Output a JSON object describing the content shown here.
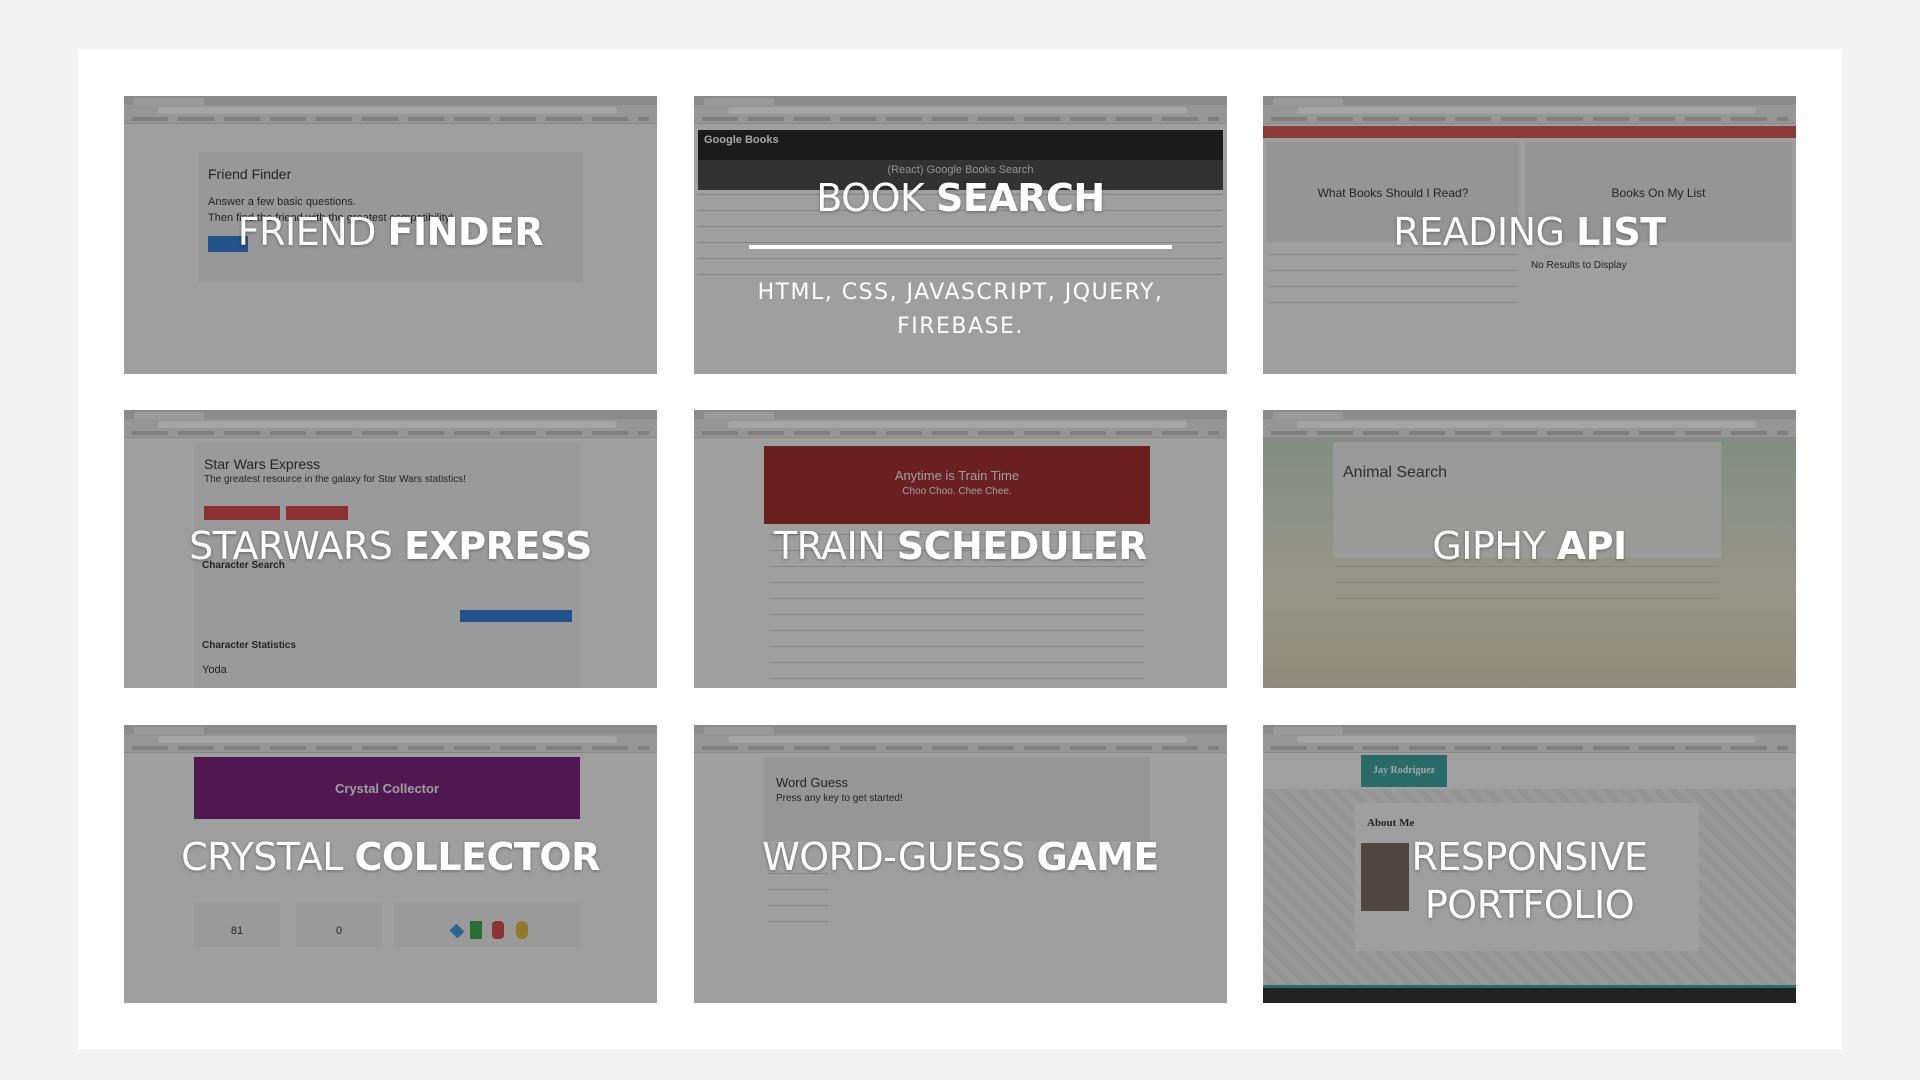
{
  "cards": [
    {
      "title_light": "FRIEND ",
      "title_bold": "FINDER",
      "app_heading": "Friend Finder",
      "app_line1": "Answer a few basic questions.",
      "app_line2": "Then find the friend with the greatest compatibility!"
    },
    {
      "title_light": "BOOK ",
      "title_bold": "SEARCH",
      "app_heading": "Google Books",
      "app_subheading": "(React) Google Books Search",
      "tech": "HTML, CSS, JAVASCRIPT, JQUERY, FIREBASE."
    },
    {
      "title_light": "READING ",
      "title_bold": "LIST",
      "col1": "What Books Should I Read?",
      "col2": "Books On My List",
      "empty": "No Results to Display"
    },
    {
      "title_light": "STARWARS ",
      "title_bold": "EXPRESS",
      "app_heading": "Star Wars Express",
      "app_tagline": "The greatest resource in the galaxy for Star Wars statistics!",
      "search_label": "Character Search",
      "stats_label": "Character Statistics",
      "stats_value": "Yoda"
    },
    {
      "title_light": "TRAIN ",
      "title_bold": "SCHEDULER",
      "banner_title": "Anytime is Train Time",
      "banner_sub": "Choo Choo. Chee Chee."
    },
    {
      "title_light": "GIPHY ",
      "title_bold": "API",
      "app_heading": "Animal Search"
    },
    {
      "title_light": "CRYSTAL ",
      "title_bold": "COLLECTOR",
      "banner_title": "Crystal Collector",
      "score": "81",
      "player": "0"
    },
    {
      "title_light": "WORD-GUESS ",
      "title_bold": "GAME",
      "app_heading": "Word Guess",
      "app_sub": "Press any key to get started!"
    },
    {
      "title_light": "RESPONSIVE",
      "title_line2": "PORTFOLIO",
      "brand": "Jay Rodriguez",
      "section": "About Me"
    }
  ]
}
